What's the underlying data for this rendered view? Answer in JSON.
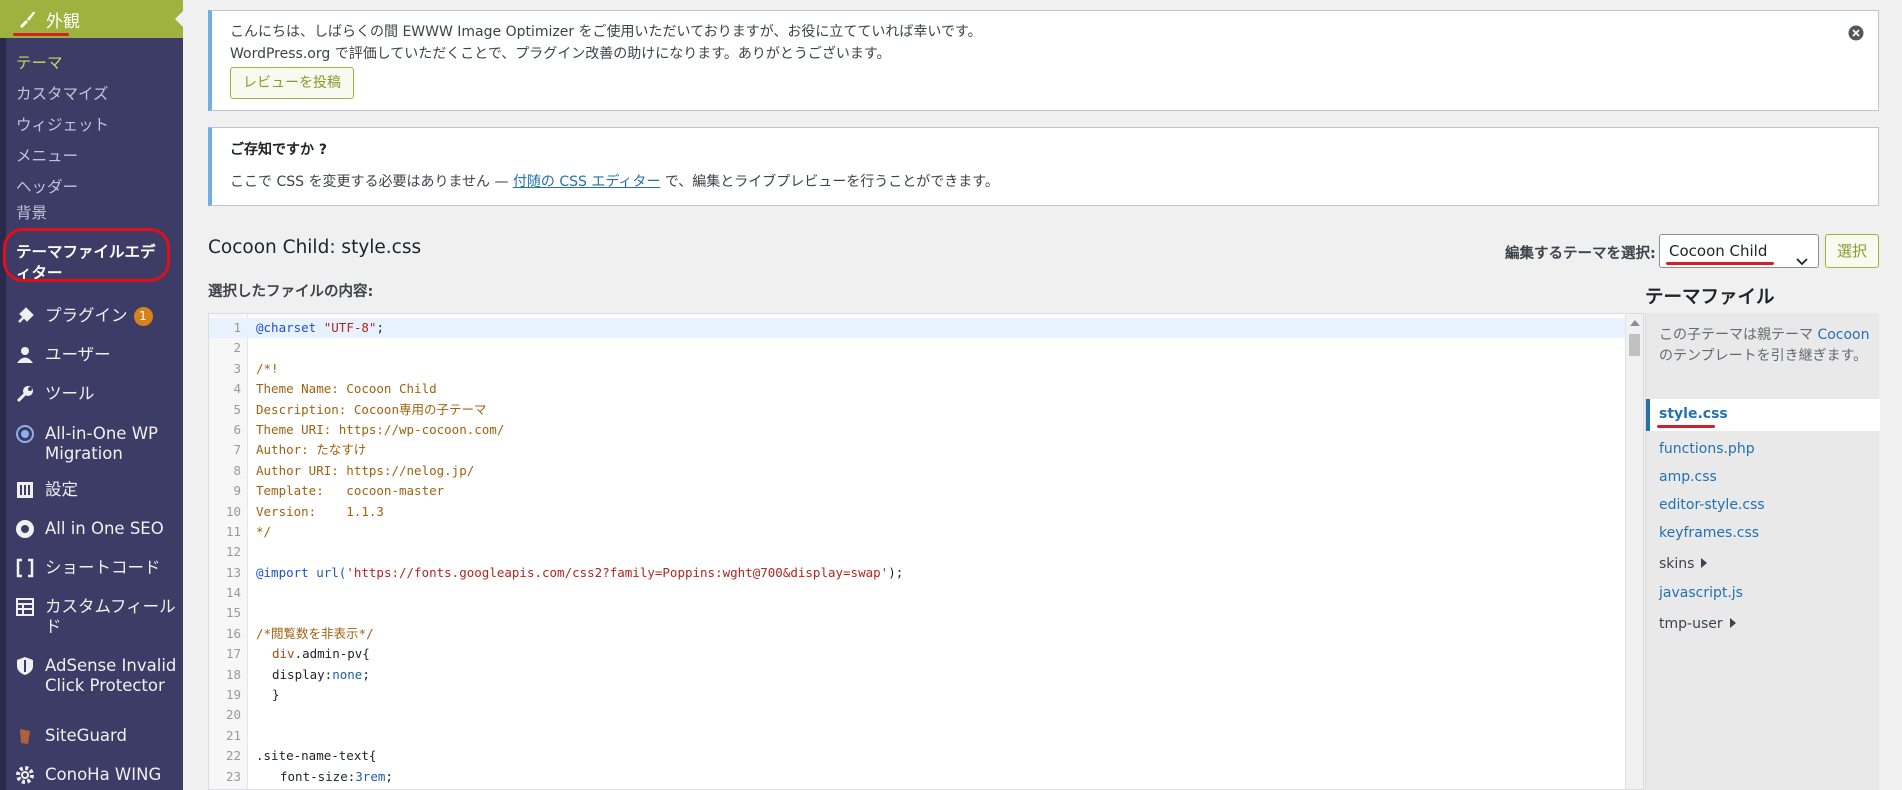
{
  "sidebar": {
    "active_menu": "外観",
    "submenu": [
      "テーマ",
      "カスタマイズ",
      "ウィジェット",
      "メニュー",
      "ヘッダー",
      "背景"
    ],
    "submenu_current": "テーマファイルエディター",
    "menu": [
      {
        "label": "プラグイン",
        "icon": "plugin-icon",
        "badge": "1"
      },
      {
        "label": "ユーザー",
        "icon": "user-icon"
      },
      {
        "label": "ツール",
        "icon": "wrench-icon"
      },
      {
        "label": "All-in-One WP Migration",
        "icon": "migration-icon"
      },
      {
        "label": "設定",
        "icon": "settings-icon"
      },
      {
        "label": "All in One SEO",
        "icon": "seo-icon"
      },
      {
        "label": "ショートコード",
        "icon": "shortcode-icon"
      },
      {
        "label": "カスタムフィールド",
        "icon": "table-icon"
      },
      {
        "label": "AdSense Invalid Click Protector",
        "icon": "shield-icon"
      },
      {
        "label": "SiteGuard",
        "icon": "siteguard-icon"
      },
      {
        "label": "ConoHa WING",
        "icon": "gear-icon"
      }
    ]
  },
  "notices": {
    "ewww": {
      "line1": "こんにちは、しばらくの間 EWWW Image Optimizer をご使用いただいておりますが、お役に立てていれば幸いです。",
      "line2": "WordPress.org で評価していただくことで、プラグイン改善の助けになります。ありがとうございます。",
      "button": "レビューを投稿"
    },
    "css": {
      "title": "ご存知ですか ?",
      "before": "ここで CSS を変更する必要はありません — ",
      "link": "付随の CSS エディター",
      "after": " で、編集とライブプレビューを行うことができます。"
    }
  },
  "header": {
    "title": "Cocoon Child: style.css",
    "theme_label": "編集するテーマを選択:",
    "theme_selected": "Cocoon Child",
    "select_button": "選択",
    "content_label": "選択したファイルの内容:"
  },
  "files": {
    "heading": "テーマファイル",
    "note_before": "この子テーマは親テーマ ",
    "note_link": "Cocoon",
    "note_after": " のテンプレートを引き継ぎます。",
    "current": "style.css",
    "items": [
      "functions.php",
      "amp.css",
      "editor-style.css",
      "keyframes.css"
    ],
    "folder1": "skins",
    "item_js": "javascript.js",
    "folder2": "tmp-user"
  },
  "code": {
    "line_numbers": [
      "1",
      "2",
      "3",
      "4",
      "5",
      "6",
      "7",
      "8",
      "9",
      "10",
      "11",
      "12",
      "13",
      "14",
      "15",
      "16",
      "17",
      "18",
      "19",
      "20",
      "21",
      "22",
      "23"
    ],
    "l1_at": "@charset",
    "l1_str": "\"UTF-8\"",
    "l1_end": ";",
    "l3": "/*!",
    "l4": "Theme Name: Cocoon Child",
    "l5": "Description: Cocoon専用の子テーマ",
    "l6": "Theme URI: https://wp-cocoon.com/",
    "l7": "Author: たなすけ",
    "l8": "Author URI: https://nelog.jp/",
    "l9": "Template:   cocoon-master",
    "l10": "Version:    1.1.3",
    "l11": "*/",
    "l13_at": "@import",
    "l13_fn": "url(",
    "l13_str": "'https://fonts.googleapis.com/css2?family=Poppins:wght@700&display=swap'",
    "l13_end": ");",
    "l16": "/*閲覧数を非表示*/",
    "l17_sel": "div",
    "l17_rest": ".admin-pv{",
    "l18_prop": "display:",
    "l18_val": "none",
    "l18_end": ";",
    "l19": "}",
    "l22": ".site-name-text{",
    "l23_prop": "font-size:",
    "l23_val": "3rem",
    "l23_end": ";"
  },
  "colors": {
    "sidebar": "#3c3c66",
    "active": "#9fb23f",
    "annotation_red": "#d0202a",
    "link": "#2271b1"
  }
}
